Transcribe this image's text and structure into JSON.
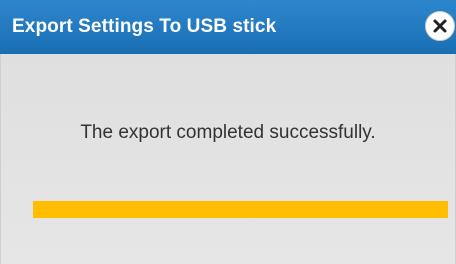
{
  "dialog": {
    "title": "Export Settings To USB stick",
    "close_icon": "close-icon",
    "message": "The export completed successfully.",
    "progress_fraction": 1.0,
    "colors": {
      "titlebar": "#1f78c1",
      "progress": "#ffbf00",
      "body": "#e2e2e2"
    }
  }
}
